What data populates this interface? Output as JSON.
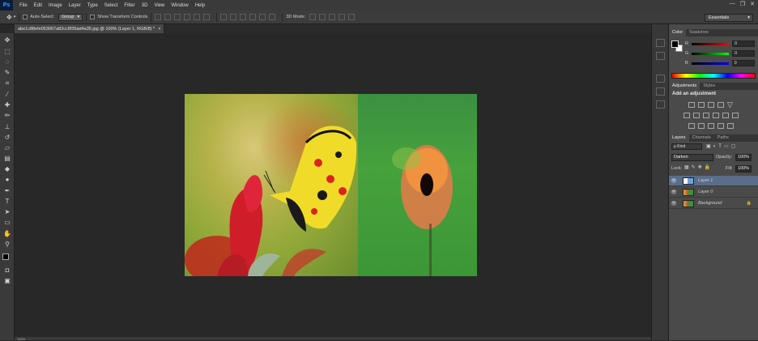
{
  "app": {
    "logo": "Ps"
  },
  "menu": [
    "File",
    "Edit",
    "Image",
    "Layer",
    "Type",
    "Select",
    "Filter",
    "3D",
    "View",
    "Window",
    "Help"
  ],
  "window_controls": [
    "—",
    "❐",
    "✕"
  ],
  "options": {
    "auto_select_label": "Auto-Select:",
    "auto_select_value": "Group",
    "show_transform_label": "Show Transform Controls",
    "mode_3d_label": "3D Mode:",
    "workspace": "Essentials"
  },
  "document": {
    "tab_title": "abe1c88efe053067a82cc8f39ad4a35.jpg @ 100% (Layer 1, RGB/8) *"
  },
  "status": {
    "zoom": "100%"
  },
  "color_panel": {
    "tabs": [
      "Color",
      "Swatches"
    ],
    "r_label": "R",
    "r_value": "0",
    "g_label": "G",
    "g_value": "0",
    "b_label": "B",
    "b_value": "0"
  },
  "adjustments_panel": {
    "tabs": [
      "Adjustments",
      "Styles"
    ],
    "heading": "Add an adjustment"
  },
  "layers_panel": {
    "tabs": [
      "Layers",
      "Channels",
      "Paths"
    ],
    "kind_label": "ρ Kind",
    "blend_mode": "Darken",
    "opacity_label": "Opacity:",
    "opacity_value": "100%",
    "lock_label": "Lock:",
    "fill_label": "Fill:",
    "fill_value": "100%",
    "layers": [
      {
        "name": "Layer 1"
      },
      {
        "name": "Layer 0"
      },
      {
        "name": "Background"
      }
    ]
  },
  "colors": {
    "selected_layer": "#5a6e8a",
    "accent": "#31a8ff"
  }
}
